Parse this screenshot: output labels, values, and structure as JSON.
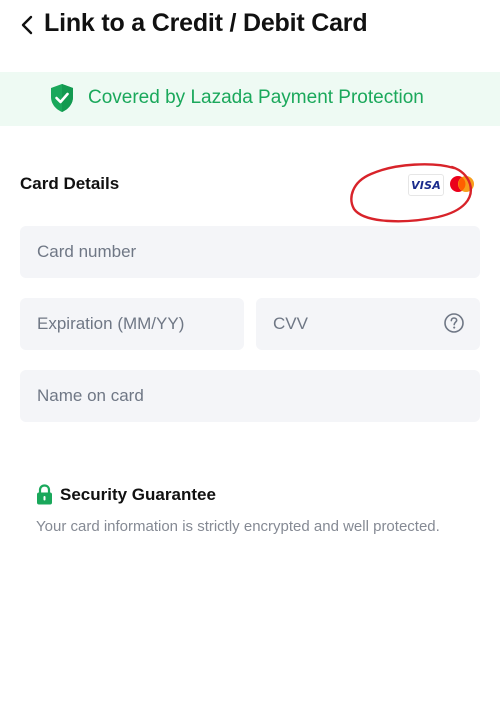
{
  "header": {
    "title": "Link to a Credit / Debit Card",
    "back_icon": "chevron-left-icon"
  },
  "banner": {
    "text": "Covered by Lazada Payment Protection",
    "icon": "shield-check-icon",
    "color": "#1aa85b",
    "background": "#eefaf3"
  },
  "card_details": {
    "title": "Card Details",
    "brands": {
      "visa": "VISA",
      "mastercard_icon": "mastercard-icon"
    },
    "annotation": "red-hand-drawn-circle"
  },
  "form": {
    "card_number": {
      "placeholder": "Card number",
      "value": ""
    },
    "expiration": {
      "placeholder": "Expiration (MM/YY)",
      "value": ""
    },
    "cvv": {
      "placeholder": "CVV",
      "value": "",
      "help_icon": "question-circle-icon"
    },
    "name_on_card": {
      "placeholder": "Name on card",
      "value": ""
    }
  },
  "security": {
    "title": "Security Guarantee",
    "icon": "lock-icon",
    "text": "Your card information is strictly encrypted and well protected."
  }
}
